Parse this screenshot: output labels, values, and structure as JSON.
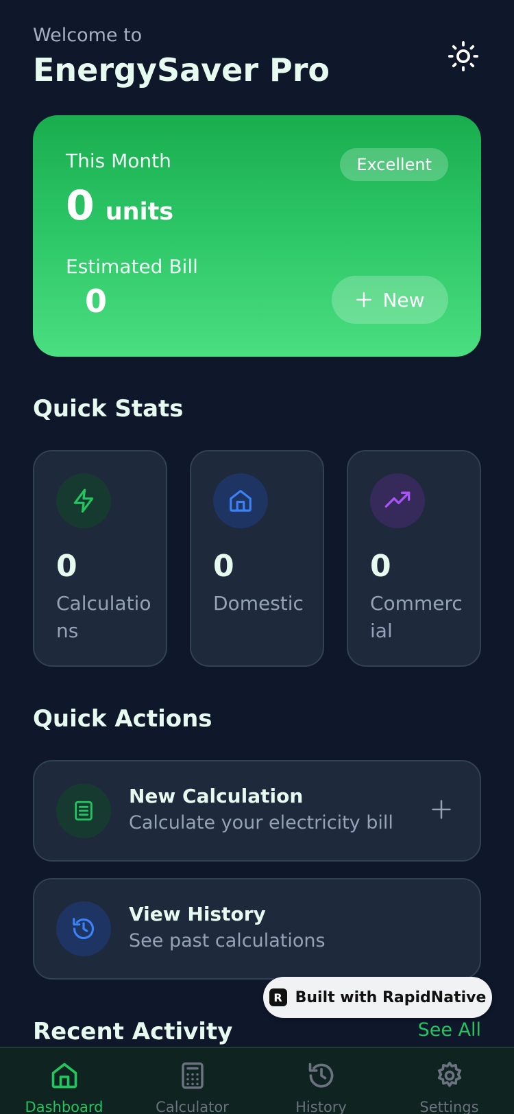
{
  "header": {
    "welcome": "Welcome to",
    "title": "EnergySaver Pro"
  },
  "hero": {
    "label": "This Month",
    "units_value": "0",
    "units_label": "units",
    "badge": "Excellent",
    "bill_label": "Estimated Bill",
    "bill_value": "0",
    "new_label": "New"
  },
  "quick_stats": {
    "title": "Quick Stats",
    "items": [
      {
        "value": "0",
        "label": "Calculations",
        "icon": "lightning-icon",
        "color": "#22c55e"
      },
      {
        "value": "0",
        "label": "Domestic",
        "icon": "home-icon",
        "color": "#3b82f6"
      },
      {
        "value": "0",
        "label": "Commercial",
        "icon": "trending-up-icon",
        "color": "#a855f7"
      }
    ]
  },
  "quick_actions": {
    "title": "Quick Actions",
    "items": [
      {
        "title": "New Calculation",
        "subtitle": "Calculate your electricity bill",
        "icon": "document-icon"
      },
      {
        "title": "View History",
        "subtitle": "See past calculations",
        "icon": "history-icon"
      }
    ]
  },
  "recent_activity": {
    "title": "Recent Activity",
    "see_all": "See All"
  },
  "built_with": "Built with RapidNative",
  "tabs": [
    {
      "label": "Dashboard",
      "icon": "home-icon",
      "active": true
    },
    {
      "label": "Calculator",
      "icon": "calculator-icon",
      "active": false
    },
    {
      "label": "History",
      "icon": "history-icon",
      "active": false
    },
    {
      "label": "Settings",
      "icon": "gear-icon",
      "active": false
    }
  ],
  "colors": {
    "background": "#0f172a",
    "accent": "#22c55e",
    "card": "#1e293b"
  }
}
